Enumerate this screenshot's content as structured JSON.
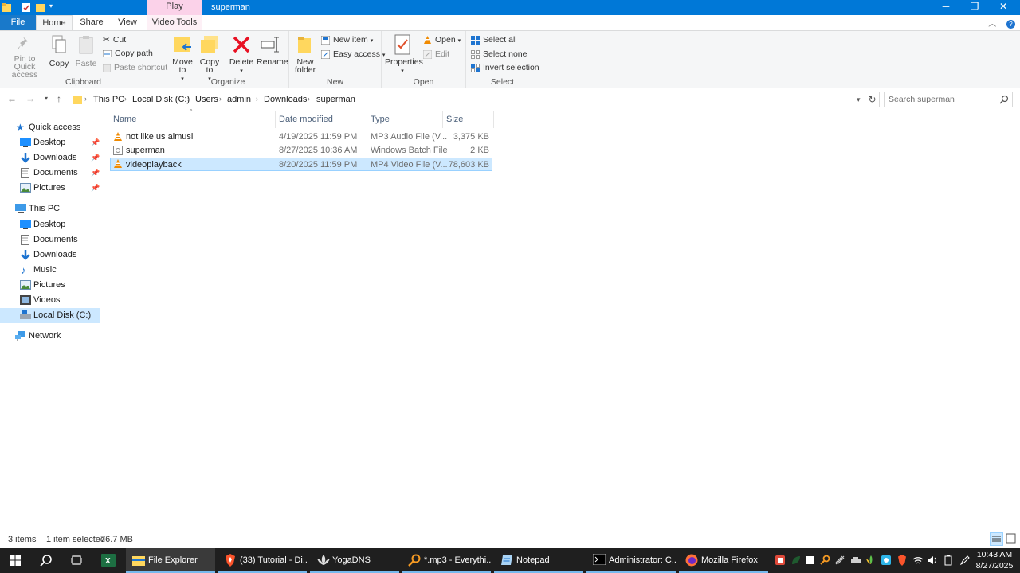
{
  "titlebar": {
    "context_tab": "Play",
    "title": "superman",
    "minimize": "─",
    "restore": "❐",
    "close": "✕"
  },
  "ribbon_tabs": {
    "file": "File",
    "home": "Home",
    "share": "Share",
    "view": "View",
    "video_tools": "Video Tools"
  },
  "ribbon": {
    "clipboard": {
      "label": "Clipboard",
      "pin": "Pin to Quick access",
      "copy": "Copy",
      "paste": "Paste",
      "cut": "Cut",
      "copy_path": "Copy path",
      "paste_shortcut": "Paste shortcut"
    },
    "organize": {
      "label": "Organize",
      "move_to": "Move to",
      "copy_to": "Copy to",
      "delete": "Delete",
      "rename": "Rename"
    },
    "new": {
      "label": "New",
      "new_folder": "New folder",
      "new_item": "New item",
      "easy_access": "Easy access"
    },
    "open": {
      "label": "Open",
      "properties": "Properties",
      "open": "Open",
      "edit": "Edit"
    },
    "select": {
      "label": "Select",
      "select_all": "Select all",
      "select_none": "Select none",
      "invert": "Invert selection"
    }
  },
  "address": {
    "crumbs": [
      "This PC",
      "Local Disk (C:)",
      "Users",
      "admin",
      "Downloads",
      "superman"
    ],
    "search_placeholder": "Search superman"
  },
  "navpane": {
    "quick_access": "Quick access",
    "quick_items": [
      "Desktop",
      "Downloads",
      "Documents",
      "Pictures"
    ],
    "this_pc": "This PC",
    "pc_items": [
      "Desktop",
      "Documents",
      "Downloads",
      "Music",
      "Pictures",
      "Videos",
      "Local Disk (C:)"
    ],
    "network": "Network"
  },
  "filelist": {
    "columns": [
      "Name",
      "Date modified",
      "Type",
      "Size"
    ],
    "rows": [
      {
        "name": "not like us aimusi",
        "date": "4/19/2025 11:59 PM",
        "type": "MP3 Audio File (V...",
        "size": "3,375 KB",
        "icon": "vlc-icon"
      },
      {
        "name": "superman",
        "date": "8/27/2025 10:36 AM",
        "type": "Windows Batch File",
        "size": "2 KB",
        "icon": "batch-file-icon"
      },
      {
        "name": "videoplayback",
        "date": "8/20/2025 11:59 PM",
        "type": "MP4 Video File (V...",
        "size": "78,603 KB",
        "icon": "vlc-icon",
        "selected": true
      }
    ]
  },
  "status": {
    "count": "3 items",
    "selected": "1 item selected",
    "size": "76.7 MB"
  },
  "taskbar": {
    "apps": [
      "File Explorer",
      "(33) Tutorial - Di...",
      "YogaDNS",
      "*.mp3 - Everythi...",
      "Notepad",
      "Administrator: C...",
      "Mozilla Firefox"
    ],
    "time": "10:43 AM",
    "date": "8/27/2025"
  },
  "colors": {
    "accent": "#0078d7",
    "selection": "#cce8ff",
    "taskbar": "#1f1f1f"
  }
}
